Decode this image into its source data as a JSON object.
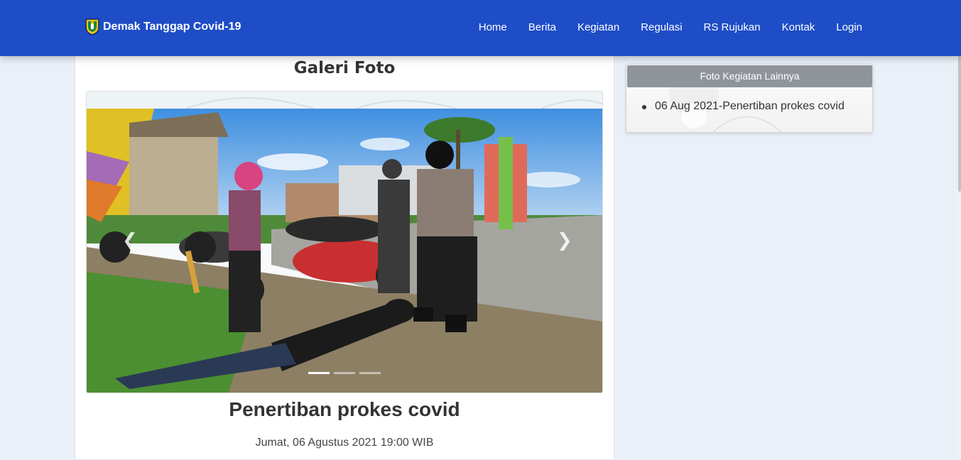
{
  "brand": {
    "name": "Demak Tanggap Covid-19",
    "logo_icon": "demak-crest-icon"
  },
  "nav": {
    "items": [
      {
        "label": "Home"
      },
      {
        "label": "Berita"
      },
      {
        "label": "Kegiatan"
      },
      {
        "label": "Regulasi"
      },
      {
        "label": "RS Rujukan"
      },
      {
        "label": "Kontak"
      },
      {
        "label": "Login"
      }
    ]
  },
  "gallery": {
    "title": "Galeri Foto",
    "carousel": {
      "slide_count": 3,
      "active_slide": 1,
      "prev_icon": "chevron-left-icon",
      "next_icon": "chevron-right-icon"
    }
  },
  "post": {
    "title": "Penertiban prokes covid",
    "date": "Jumat, 06 Agustus 2021 19:00 WIB"
  },
  "sidebar": {
    "header": "Foto Kegiatan Lainnya",
    "items": [
      {
        "label": "06 Aug 2021-Penertiban prokes covid"
      }
    ]
  },
  "colors": {
    "navbar": "#1e4dc7",
    "sidebar_header": "#8f959b",
    "page_bg": "#eaf0f7"
  }
}
